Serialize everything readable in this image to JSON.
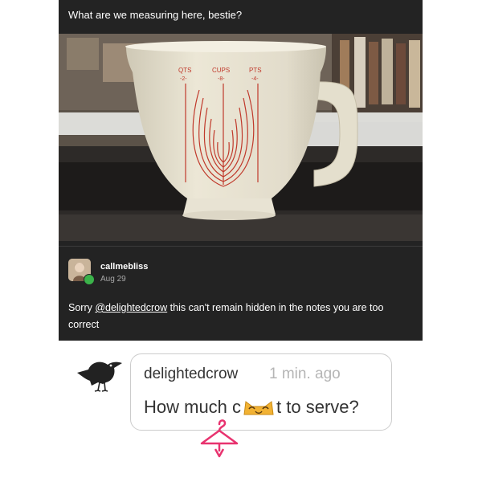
{
  "post": {
    "title": "What are we measuring here, bestie?",
    "photo_icon": "measuring-cup-photo",
    "cup_markings": {
      "qts": "QTS",
      "qts_num": "-2-",
      "cups": "CUPS",
      "cups_num": "-8-",
      "pts": "PTS",
      "pts_num": "-4-"
    },
    "reply": {
      "username": "callmebliss",
      "date": "Aug 29",
      "text_before": "Sorry ",
      "mention": "@delightedcrow",
      "text_after": " this can't remain hidden in the notes you are too correct"
    }
  },
  "comment": {
    "avatar_icon": "crow-icon",
    "username": "delightedcrow",
    "time": "1 min. ago",
    "text_before": "How much c",
    "text_emoji_icon": "cat-face-emoji",
    "text_after": "t to serve?"
  },
  "overlay_icon": "pink-hanger-icon",
  "colors": {
    "post_bg": "#232323",
    "cup_red": "#c0392b",
    "hanger_pink": "#e8336f",
    "badge_green": "#3bb34a"
  }
}
